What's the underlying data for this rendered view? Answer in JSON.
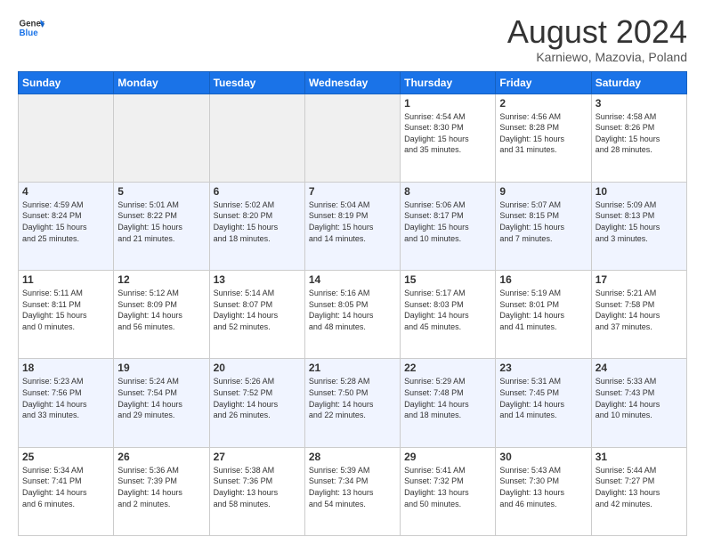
{
  "header": {
    "logo_line1": "General",
    "logo_line2": "Blue",
    "month_title": "August 2024",
    "subtitle": "Karniewo, Mazovia, Poland"
  },
  "days_of_week": [
    "Sunday",
    "Monday",
    "Tuesday",
    "Wednesday",
    "Thursday",
    "Friday",
    "Saturday"
  ],
  "weeks": [
    [
      {
        "day": "",
        "info": ""
      },
      {
        "day": "",
        "info": ""
      },
      {
        "day": "",
        "info": ""
      },
      {
        "day": "",
        "info": ""
      },
      {
        "day": "1",
        "info": "Sunrise: 4:54 AM\nSunset: 8:30 PM\nDaylight: 15 hours\nand 35 minutes."
      },
      {
        "day": "2",
        "info": "Sunrise: 4:56 AM\nSunset: 8:28 PM\nDaylight: 15 hours\nand 31 minutes."
      },
      {
        "day": "3",
        "info": "Sunrise: 4:58 AM\nSunset: 8:26 PM\nDaylight: 15 hours\nand 28 minutes."
      }
    ],
    [
      {
        "day": "4",
        "info": "Sunrise: 4:59 AM\nSunset: 8:24 PM\nDaylight: 15 hours\nand 25 minutes."
      },
      {
        "day": "5",
        "info": "Sunrise: 5:01 AM\nSunset: 8:22 PM\nDaylight: 15 hours\nand 21 minutes."
      },
      {
        "day": "6",
        "info": "Sunrise: 5:02 AM\nSunset: 8:20 PM\nDaylight: 15 hours\nand 18 minutes."
      },
      {
        "day": "7",
        "info": "Sunrise: 5:04 AM\nSunset: 8:19 PM\nDaylight: 15 hours\nand 14 minutes."
      },
      {
        "day": "8",
        "info": "Sunrise: 5:06 AM\nSunset: 8:17 PM\nDaylight: 15 hours\nand 10 minutes."
      },
      {
        "day": "9",
        "info": "Sunrise: 5:07 AM\nSunset: 8:15 PM\nDaylight: 15 hours\nand 7 minutes."
      },
      {
        "day": "10",
        "info": "Sunrise: 5:09 AM\nSunset: 8:13 PM\nDaylight: 15 hours\nand 3 minutes."
      }
    ],
    [
      {
        "day": "11",
        "info": "Sunrise: 5:11 AM\nSunset: 8:11 PM\nDaylight: 15 hours\nand 0 minutes."
      },
      {
        "day": "12",
        "info": "Sunrise: 5:12 AM\nSunset: 8:09 PM\nDaylight: 14 hours\nand 56 minutes."
      },
      {
        "day": "13",
        "info": "Sunrise: 5:14 AM\nSunset: 8:07 PM\nDaylight: 14 hours\nand 52 minutes."
      },
      {
        "day": "14",
        "info": "Sunrise: 5:16 AM\nSunset: 8:05 PM\nDaylight: 14 hours\nand 48 minutes."
      },
      {
        "day": "15",
        "info": "Sunrise: 5:17 AM\nSunset: 8:03 PM\nDaylight: 14 hours\nand 45 minutes."
      },
      {
        "day": "16",
        "info": "Sunrise: 5:19 AM\nSunset: 8:01 PM\nDaylight: 14 hours\nand 41 minutes."
      },
      {
        "day": "17",
        "info": "Sunrise: 5:21 AM\nSunset: 7:58 PM\nDaylight: 14 hours\nand 37 minutes."
      }
    ],
    [
      {
        "day": "18",
        "info": "Sunrise: 5:23 AM\nSunset: 7:56 PM\nDaylight: 14 hours\nand 33 minutes."
      },
      {
        "day": "19",
        "info": "Sunrise: 5:24 AM\nSunset: 7:54 PM\nDaylight: 14 hours\nand 29 minutes."
      },
      {
        "day": "20",
        "info": "Sunrise: 5:26 AM\nSunset: 7:52 PM\nDaylight: 14 hours\nand 26 minutes."
      },
      {
        "day": "21",
        "info": "Sunrise: 5:28 AM\nSunset: 7:50 PM\nDaylight: 14 hours\nand 22 minutes."
      },
      {
        "day": "22",
        "info": "Sunrise: 5:29 AM\nSunset: 7:48 PM\nDaylight: 14 hours\nand 18 minutes."
      },
      {
        "day": "23",
        "info": "Sunrise: 5:31 AM\nSunset: 7:45 PM\nDaylight: 14 hours\nand 14 minutes."
      },
      {
        "day": "24",
        "info": "Sunrise: 5:33 AM\nSunset: 7:43 PM\nDaylight: 14 hours\nand 10 minutes."
      }
    ],
    [
      {
        "day": "25",
        "info": "Sunrise: 5:34 AM\nSunset: 7:41 PM\nDaylight: 14 hours\nand 6 minutes."
      },
      {
        "day": "26",
        "info": "Sunrise: 5:36 AM\nSunset: 7:39 PM\nDaylight: 14 hours\nand 2 minutes."
      },
      {
        "day": "27",
        "info": "Sunrise: 5:38 AM\nSunset: 7:36 PM\nDaylight: 13 hours\nand 58 minutes."
      },
      {
        "day": "28",
        "info": "Sunrise: 5:39 AM\nSunset: 7:34 PM\nDaylight: 13 hours\nand 54 minutes."
      },
      {
        "day": "29",
        "info": "Sunrise: 5:41 AM\nSunset: 7:32 PM\nDaylight: 13 hours\nand 50 minutes."
      },
      {
        "day": "30",
        "info": "Sunrise: 5:43 AM\nSunset: 7:30 PM\nDaylight: 13 hours\nand 46 minutes."
      },
      {
        "day": "31",
        "info": "Sunrise: 5:44 AM\nSunset: 7:27 PM\nDaylight: 13 hours\nand 42 minutes."
      }
    ]
  ]
}
